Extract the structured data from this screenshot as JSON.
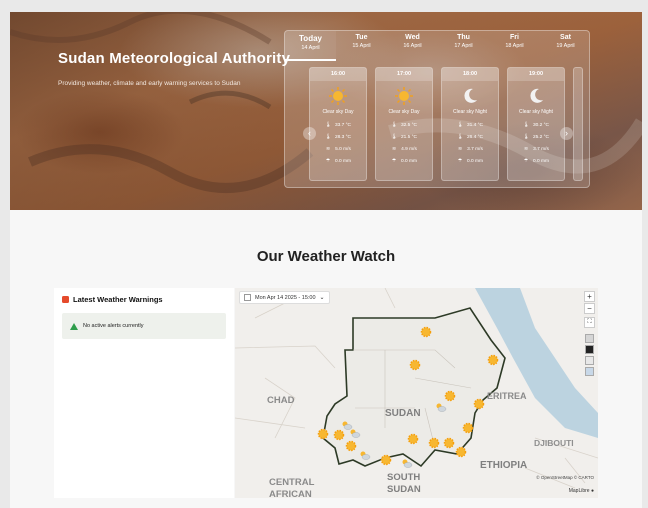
{
  "hero": {
    "title": "Sudan Meteorological Authority",
    "subtitle": "Providing weather, climate and early warning services to Sudan"
  },
  "forecast": {
    "days": [
      {
        "name": "Today",
        "date": "14 April",
        "active": true
      },
      {
        "name": "Tue",
        "date": "15 April",
        "active": false
      },
      {
        "name": "Wed",
        "date": "16 April",
        "active": false
      },
      {
        "name": "Thu",
        "date": "17 April",
        "active": false
      },
      {
        "name": "Fri",
        "date": "18 April",
        "active": false
      },
      {
        "name": "Sat",
        "date": "19 April",
        "active": false
      }
    ],
    "hours": [
      {
        "time": "16:00",
        "icon": "sun-icon",
        "condition": "Clear sky Day",
        "temp": "33.7 °C",
        "feels": "28.3 °C",
        "wind": "5.0 m/s",
        "rain": "0.0 mm"
      },
      {
        "time": "17:00",
        "icon": "sun-icon",
        "condition": "Clear sky Day",
        "temp": "32.5 °C",
        "feels": "21.5 °C",
        "wind": "4.9 m/s",
        "rain": "0.0 mm"
      },
      {
        "time": "18:00",
        "icon": "moon-icon",
        "condition": "Clear sky Night",
        "temp": "31.4 °C",
        "feels": "26.4 °C",
        "wind": "3.7 m/s",
        "rain": "0.0 mm"
      },
      {
        "time": "19:00",
        "icon": "moon-icon",
        "condition": "Clear sky Night",
        "temp": "30.2 °C",
        "feels": "25.2 °C",
        "wind": "3.7 m/s",
        "rain": "0.0 mm"
      }
    ]
  },
  "section": {
    "title": "Our Weather Watch"
  },
  "warnings": {
    "heading": "Latest Weather Warnings",
    "status": "No active alerts currently",
    "accent": "#e54b2c",
    "ok_color": "#2e9d4b"
  },
  "map": {
    "time_select": "Mon Apr 14 2025 - 15:00",
    "labels": {
      "chad": "CHAD",
      "sudan": "SUDAN",
      "eritrea": "ERITREA",
      "djibouti": "DJIBOUTI",
      "ethiopia": "ETHIOPIA",
      "south_sudan_1": "SOUTH",
      "south_sudan_2": "SUDAN",
      "car_1": "CENTRAL",
      "car_2": "AFRICAN"
    },
    "zoom_in": "+",
    "zoom_out": "−",
    "attribution": "© OpenStreetMap © CARTO",
    "engine": "MapLibre"
  }
}
